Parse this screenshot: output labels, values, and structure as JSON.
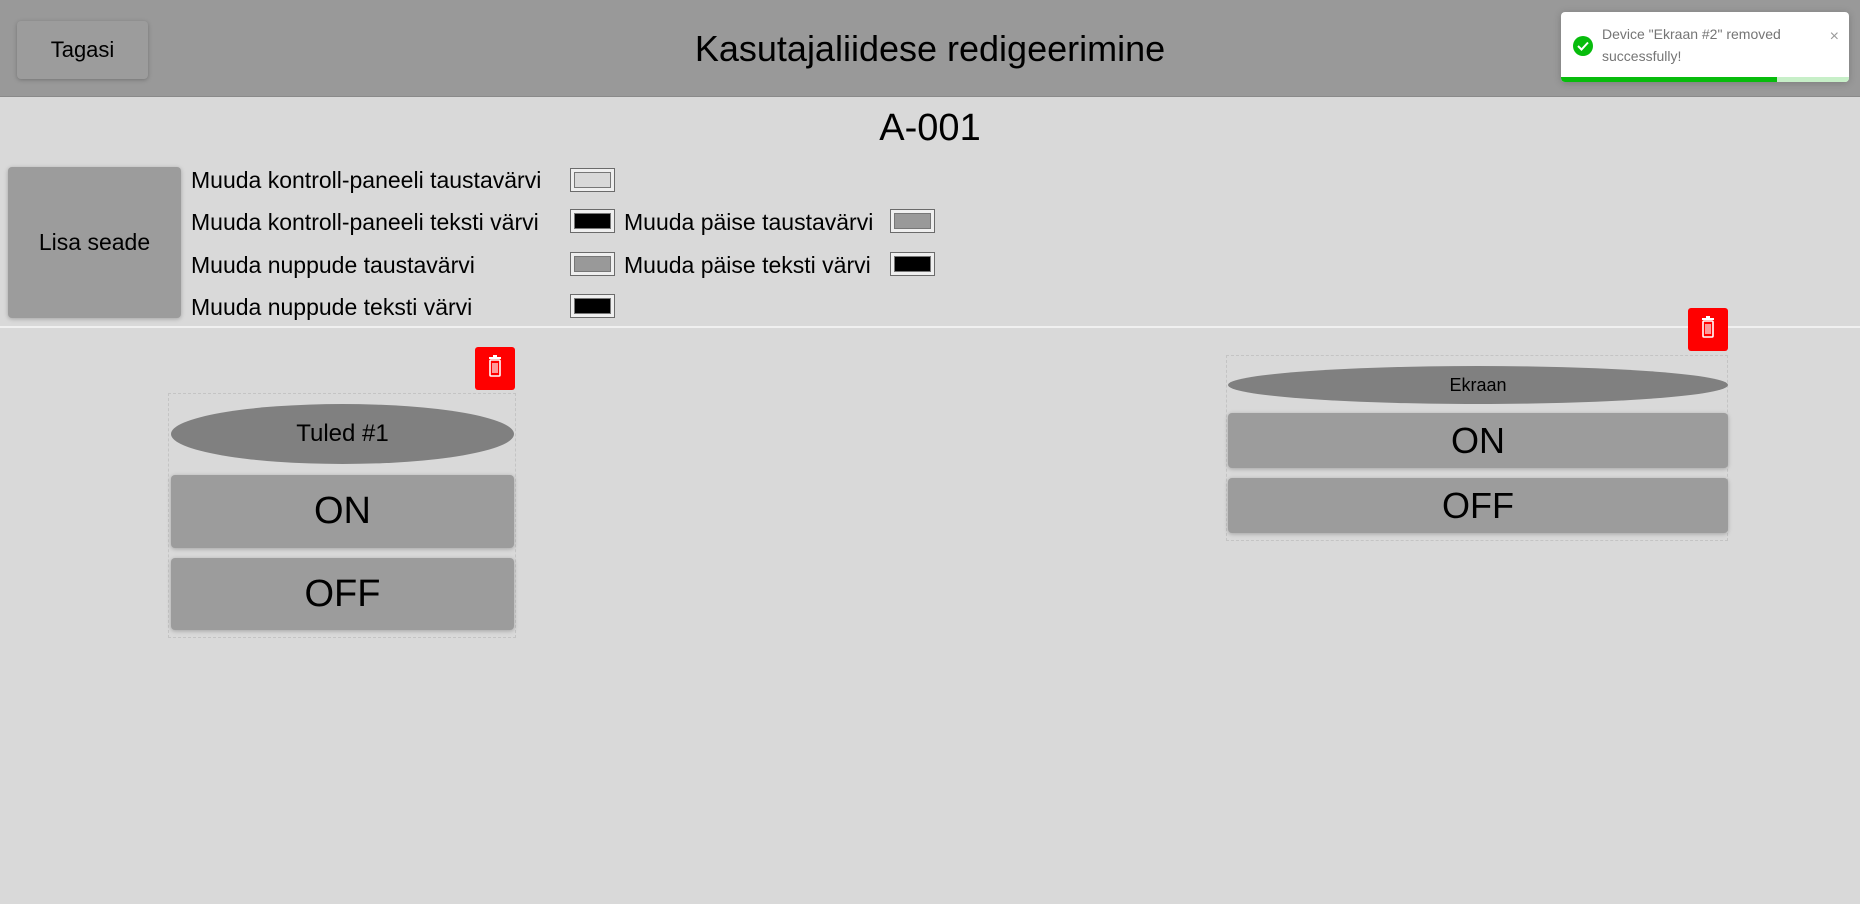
{
  "header": {
    "back_label": "Tagasi",
    "title": "Kasutajaliidese redigeerimine"
  },
  "room": {
    "title": "A-001"
  },
  "add_device_label": "Lisa seade",
  "color_settings": {
    "panel_bg": {
      "label": "Muuda kontroll-paneeli taustavärvi",
      "color": "#d9d9d9"
    },
    "panel_text": {
      "label": "Muuda kontroll-paneeli teksti värvi",
      "color": "#000000"
    },
    "button_bg": {
      "label": "Muuda nuppude taustavärvi",
      "color": "#999999"
    },
    "button_text": {
      "label": "Muuda nuppude teksti värvi",
      "color": "#000000"
    },
    "header_bg": {
      "label": "Muuda päise taustavärvi",
      "color": "#999999"
    },
    "header_text": {
      "label": "Muuda päise teksti värvi",
      "color": "#000000"
    }
  },
  "devices": [
    {
      "name": "Tuled #1",
      "on_label": "ON",
      "off_label": "OFF",
      "icon": "trash-icon"
    },
    {
      "name": "Ekraan",
      "on_label": "ON",
      "off_label": "OFF",
      "icon": "trash-icon"
    }
  ],
  "toast": {
    "message": "Device \"Ekraan #2\" removed successfully!",
    "status": "success",
    "accent_color": "#07bc0c",
    "close_symbol": "×",
    "progress": 0.75
  }
}
